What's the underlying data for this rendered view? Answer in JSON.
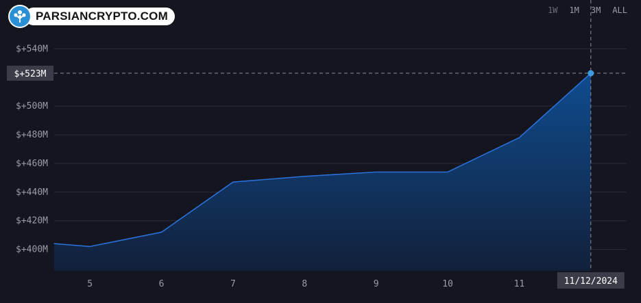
{
  "brand": {
    "name": "PARSIANCRYPTO.COM",
    "logo_icon": "tree-icon"
  },
  "range_buttons": [
    {
      "label": "1W",
      "active": false
    },
    {
      "label": "1M",
      "active": false
    },
    {
      "label": "3M",
      "active": true
    },
    {
      "label": "ALL",
      "active": false
    }
  ],
  "colors": {
    "background": "#14151f",
    "line": "#2a6fd6",
    "fill_top": "#0f4c8f",
    "fill_bottom": "#12203a",
    "marker": "#3d9be0",
    "axis_text": "#9a9ca6",
    "grid": "#2a2d3a",
    "crosshair_label_bg": "#3a3d48"
  },
  "chart_data": {
    "type": "area",
    "x": [
      4.5,
      5,
      6,
      7,
      8,
      9,
      10,
      11,
      12.0
    ],
    "values": [
      404,
      402,
      412,
      447,
      451,
      454,
      454,
      478,
      523
    ],
    "x_ticks": [
      5,
      6,
      7,
      8,
      9,
      10,
      11
    ],
    "y_ticks": [
      400,
      420,
      440,
      460,
      480,
      500,
      540
    ],
    "y_tick_labels": [
      "$+400M",
      "$+420M",
      "$+440M",
      "$+460M",
      "$+480M",
      "$+500M",
      "$+540M"
    ],
    "xlim": [
      4.5,
      12.5
    ],
    "ylim": [
      385,
      555
    ],
    "grid": true,
    "crosshair": {
      "x": 12.0,
      "y": 523,
      "y_label": "$+523M",
      "x_label": "11/12/2024"
    }
  }
}
